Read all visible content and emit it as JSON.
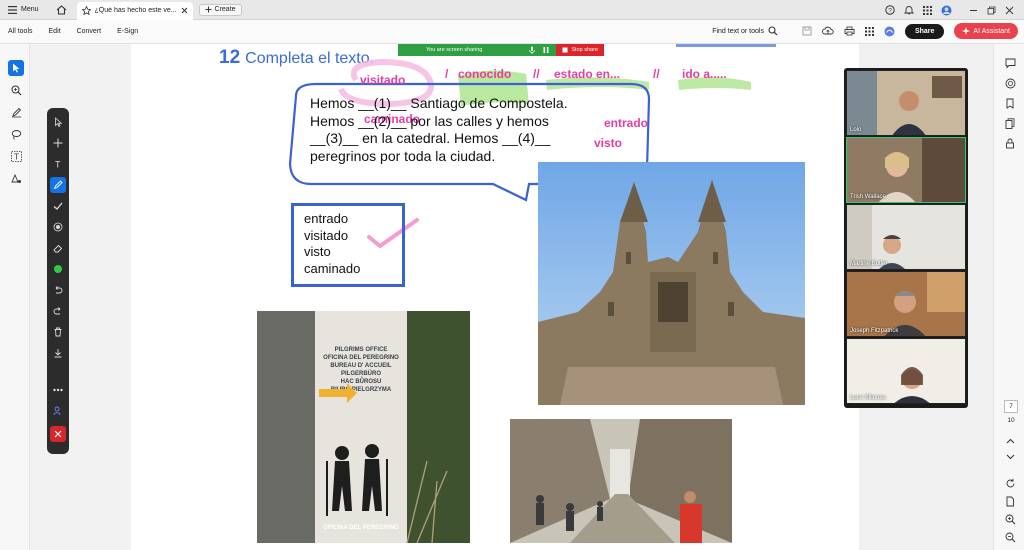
{
  "browser": {
    "menu_label": "Menu",
    "tab_title": "¿Qué has hecho este ve...",
    "create_label": "Create"
  },
  "toolbar": {
    "items": [
      "All tools",
      "Edit",
      "Convert",
      "E-Sign"
    ],
    "find_label": "Find text or tools",
    "share_label": "Share",
    "ai_label": "AI Assistant"
  },
  "share_banner": {
    "text": "You are screen sharing",
    "stop_label": "Stop share"
  },
  "document": {
    "exercise_number": "12",
    "exercise_title": "Completa el texto.",
    "bubble_lines": [
      "Hemos __(1)__ Santiago de Compostela.",
      "Hemos __(2)__ por las calles y hemos",
      "__(3)__ en la catedral. Hemos __(4)__",
      "peregrinos por toda la ciudad."
    ],
    "word_options": [
      "entrado",
      "visitado",
      "visto",
      "caminado"
    ],
    "annotations": {
      "a1": "visitado",
      "a2": "/",
      "a3": "conocido",
      "a4": "//",
      "a5": "estado en...",
      "a6": "//",
      "a7": "ido a.....",
      "a8": "caminado",
      "a9": "entrado",
      "a10": "visto"
    },
    "pilgrim_sign_lines": [
      "PILGRIMS OFFICE",
      "OFICINA DEL PEREGRINO",
      "BUREAU D' ACCUEIL",
      "PILGERBÜRO",
      "HAC BŮROSU",
      "BIURO PIELGRZYMA"
    ],
    "pilgrim_sign_footer": "OFICINA DEL PEREGRINO"
  },
  "participants": [
    "Lolo",
    "Trish Wallace",
    "Martine Butler",
    "Joseph Fitzpatrick",
    "Luce Siliunas"
  ],
  "page_nav": {
    "current": "7",
    "total": "10"
  },
  "colors": {
    "accent_blue": "#3a6bd8",
    "annotation_pink": "#e53ea3",
    "highlight_green": "#9ee07a",
    "share_green": "#2ea043",
    "stop_red": "#d9262b"
  }
}
